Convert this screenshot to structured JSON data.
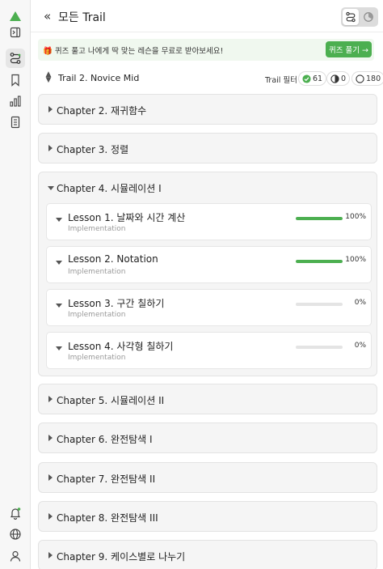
{
  "colors": {
    "accent": "#4caf50",
    "rail_bg": "#f7f7f7",
    "card_bg": "#f5f5f5",
    "banner_bg": "#f0f8ef"
  },
  "rail": {
    "icons": [
      "logo-icon",
      "panel-toggle-icon",
      "route-icon",
      "bookmark-icon",
      "bar-chart-icon",
      "document-icon",
      "bell-icon",
      "globe-icon",
      "user-icon"
    ]
  },
  "header": {
    "title": "모든 Trail",
    "back_icon": "double-chevron-left-icon",
    "view_toggle": {
      "active": "route-view",
      "inactive": "timer-view"
    }
  },
  "banner": {
    "text": "🎁 퀴즈 풀고 나에게 딱 맞는 레슨을 무료로 받아보세요!",
    "button_label": "퀴즈 풀기 →"
  },
  "trail": {
    "name": "Trail 2. Novice Mid",
    "filter_label": "Trail 필터",
    "filters": [
      {
        "icon": "check-circle-icon",
        "count": "61"
      },
      {
        "icon": "half-circle-icon",
        "count": "0"
      },
      {
        "icon": "empty-circle-icon",
        "count": "180"
      }
    ]
  },
  "chapters": [
    {
      "title": "Chapter 2. 재귀함수",
      "expanded": false
    },
    {
      "title": "Chapter 3. 정렬",
      "expanded": false
    },
    {
      "title": "Chapter 4. 시뮬레이션 I",
      "expanded": true
    },
    {
      "title": "Chapter 5. 시뮬레이션 II",
      "expanded": false
    },
    {
      "title": "Chapter 6. 완전탐색 I",
      "expanded": false
    },
    {
      "title": "Chapter 7. 완전탐색 II",
      "expanded": false
    },
    {
      "title": "Chapter 8. 완전탐색 III",
      "expanded": false
    },
    {
      "title": "Chapter 9. 케이스별로 나누기",
      "expanded": false
    }
  ],
  "lessons": [
    {
      "title": "Lesson 1. 날짜와 시간 계산",
      "tag": "Implementation",
      "progress_label": "100%",
      "progress": 1.0
    },
    {
      "title": "Lesson 2. Notation",
      "tag": "Implementation",
      "progress_label": "100%",
      "progress": 1.0
    },
    {
      "title": "Lesson 3. 구간 칠하기",
      "tag": "Implementation",
      "progress_label": "0%",
      "progress": 0.0
    },
    {
      "title": "Lesson 4. 사각형 칠하기",
      "tag": "Implementation",
      "progress_label": "0%",
      "progress": 0.0
    }
  ]
}
